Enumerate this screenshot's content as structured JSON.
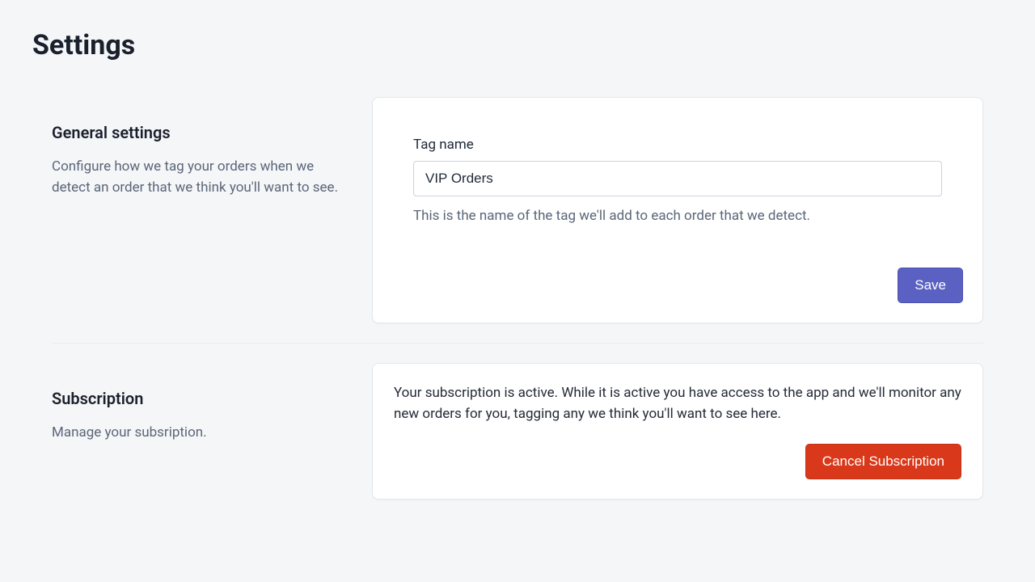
{
  "page": {
    "title": "Settings"
  },
  "general": {
    "heading": "General settings",
    "description": "Configure how we tag your orders when we detect an order that we think you'll want to see.",
    "tag_label": "Tag name",
    "tag_value": "VIP Orders",
    "tag_help": "This is the name of the tag we'll add to each order that we detect.",
    "save_label": "Save"
  },
  "subscription": {
    "heading": "Subscription",
    "description": "Manage your subsription.",
    "status_text": "Your subscription is active. While it is active you have access to the app and we'll monitor any new orders for you, tagging any we think you'll want to see here.",
    "cancel_label": "Cancel Subscription"
  }
}
